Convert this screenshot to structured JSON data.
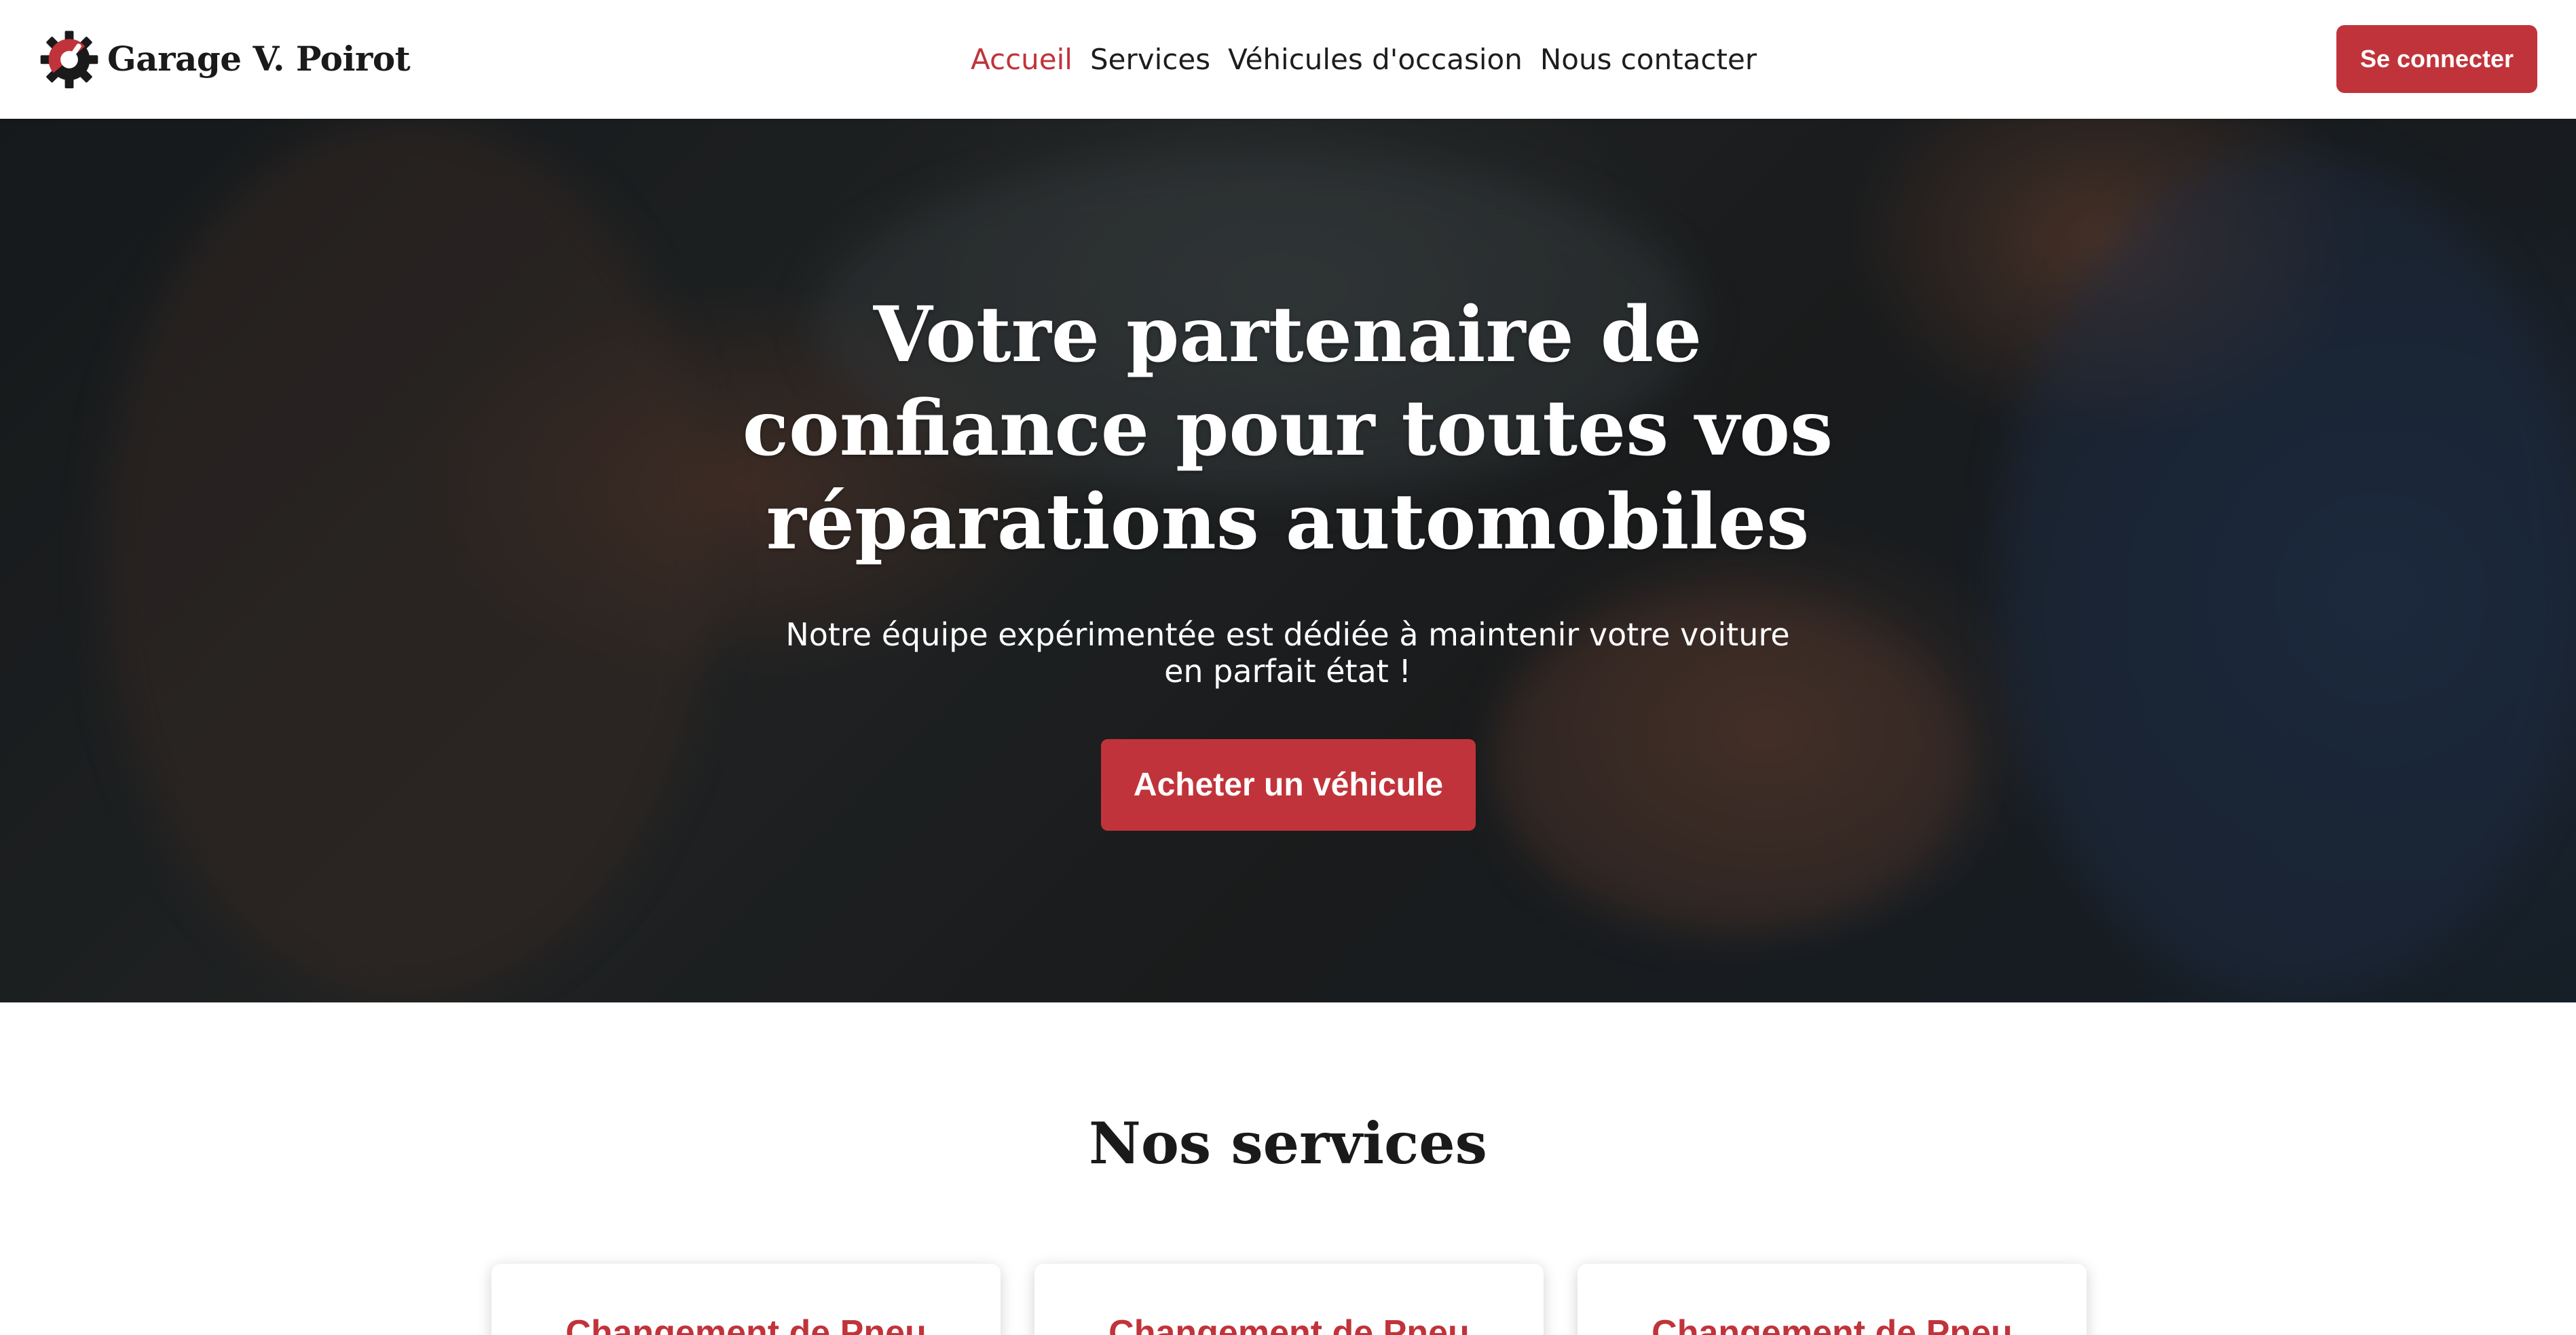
{
  "colors": {
    "accent": "#c1333a",
    "text_dark": "#1a1a1a",
    "white": "#ffffff"
  },
  "navbar": {
    "logo_icon": "gear-with-wrench-icon",
    "brand_name": "Garage V. Poirot",
    "links": [
      {
        "label": "Accueil",
        "active": true
      },
      {
        "label": "Services",
        "active": false
      },
      {
        "label": "Véhicules d'occasion",
        "active": false
      },
      {
        "label": "Nous contacter",
        "active": false
      }
    ],
    "login_label": "Se connecter"
  },
  "hero": {
    "title": "Votre partenaire de confiance pour toutes vos réparations automobiles",
    "subtitle": "Notre équipe expérimentée est dédiée à maintenir votre voiture en parfait état !",
    "cta_label": "Acheter un véhicule"
  },
  "services": {
    "title": "Nos services",
    "cards": [
      {
        "title": "Changement de Pneu"
      },
      {
        "title": "Changement de Pneu"
      },
      {
        "title": "Changement de Pneu"
      }
    ]
  }
}
